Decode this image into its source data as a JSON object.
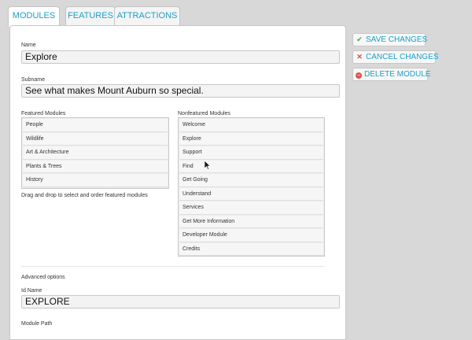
{
  "tabs": [
    {
      "label": "MODULES",
      "active": true
    },
    {
      "label": "FEATURES",
      "active": false
    },
    {
      "label": "ATTRACTIONS",
      "active": false
    }
  ],
  "form": {
    "name_label": "Name",
    "name_value": "Explore",
    "subname_label": "Subname",
    "subname_value": "See what makes Mount Auburn so special.",
    "featured_label": "Featured Modules",
    "featured_items": [
      "People",
      "Wildlife",
      "Art & Architecture",
      "Plants & Trees",
      "History"
    ],
    "featured_hint": "Drag and drop to select and order featured modules",
    "nonfeatured_label": "Nonfeatured Modules",
    "nonfeatured_items": [
      "Welcome",
      "Explore",
      "Support",
      "Find",
      "Get Going",
      "Understand",
      "Services",
      "Get More Information",
      "Developer Module",
      "Credits"
    ],
    "advanced_label": "Advanced options",
    "idname_label": "Id Name",
    "idname_value": "EXPLORE",
    "modulepath_label": "Module Path"
  },
  "actions": {
    "save": "SAVE CHANGES",
    "cancel": "CANCEL CHANGES",
    "delete": "DELETE MODULE"
  },
  "colors": {
    "accent": "#1aa0c8",
    "save_icon": "#3aa53a",
    "cancel_icon": "#e04848",
    "delete_icon": "#e05252"
  },
  "icons": {
    "save": "check-icon",
    "cancel": "x-icon",
    "delete": "minus-circle-icon"
  }
}
